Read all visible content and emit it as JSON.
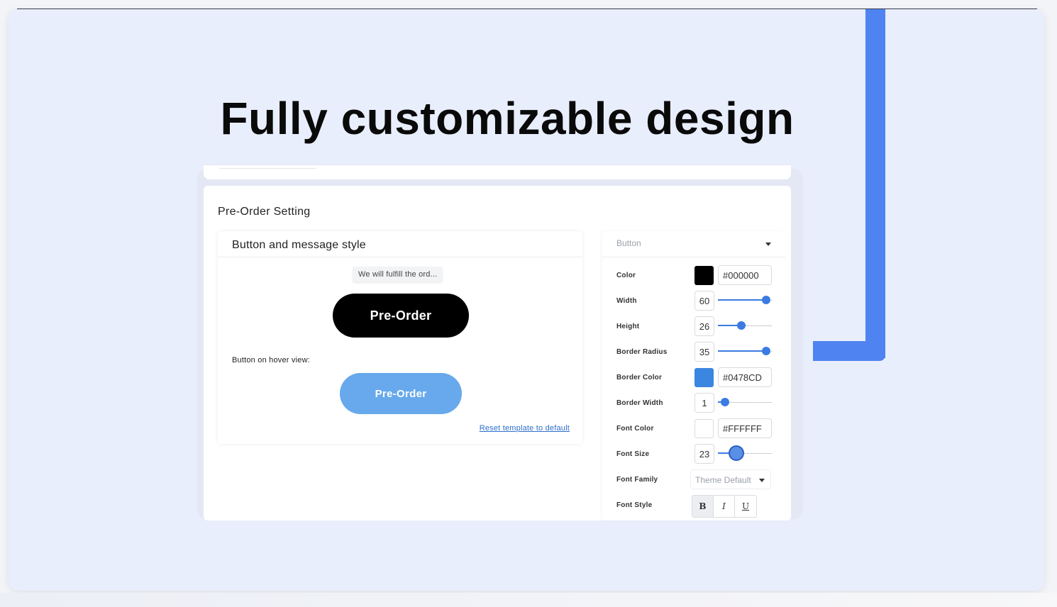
{
  "headline": "Fully customizable design",
  "card": {
    "title": "Pre-Order Setting"
  },
  "preview": {
    "title": "Button and message style",
    "tooltip": "We will fulfill the ord...",
    "button_label": "Pre-Order",
    "hover_label": "Button on hover view:",
    "hover_button_label": "Pre-Order",
    "reset_link": "Reset template to default"
  },
  "panel": {
    "selected": "Button",
    "color": {
      "label": "Color",
      "hex": "#000000"
    },
    "width": {
      "label": "Width",
      "value": "60",
      "fraction": 0.9
    },
    "height": {
      "label": "Height",
      "value": "26",
      "fraction": 0.43
    },
    "border_radius": {
      "label": "Border Radius",
      "value": "35",
      "fraction": 0.9
    },
    "border_color": {
      "label": "Border Color",
      "hex": "#0478CD"
    },
    "border_width": {
      "label": "Border Width",
      "value": "1",
      "fraction": 0.13
    },
    "font_color": {
      "label": "Font Color",
      "hex": "#FFFFFF"
    },
    "font_size": {
      "label": "Font Size",
      "value": "23",
      "fraction": 0.34
    },
    "font_family": {
      "label": "Font Family",
      "value": "Theme Default"
    },
    "font_style": {
      "label": "Font Style",
      "bold": "B",
      "italic": "I",
      "underline": "U"
    }
  },
  "colors": {
    "accent": "#4f83f1",
    "swatch_black": "#000000",
    "swatch_blue": "#3b86e0",
    "swatch_white": "#ffffff"
  }
}
